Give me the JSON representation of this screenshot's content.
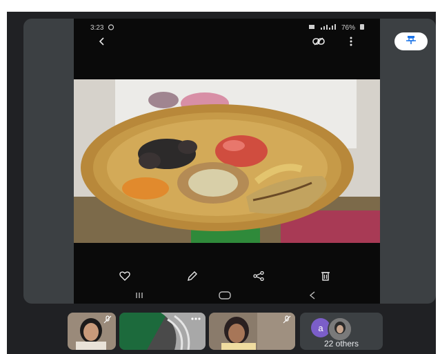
{
  "status_bar": {
    "time": "3:23",
    "battery": "76%"
  },
  "phone_toolbar": {
    "back_icon": "back-arrow-icon",
    "link_icon": "link-icon",
    "more_icon": "more-vert-icon"
  },
  "photo_actions": [
    "heart-icon",
    "pencil-icon",
    "share-icon",
    "trash-icon"
  ],
  "nav_bar": [
    "recents-icon",
    "home-icon",
    "back-icon"
  ],
  "pin": {
    "icon": "pin-icon"
  },
  "participants": {
    "others_initial": "a",
    "others_label": "22 others"
  },
  "colors": {
    "meet_bg": "#202124",
    "tile_bg": "#3c4043",
    "avatar_accent": "#7b5ec9"
  }
}
